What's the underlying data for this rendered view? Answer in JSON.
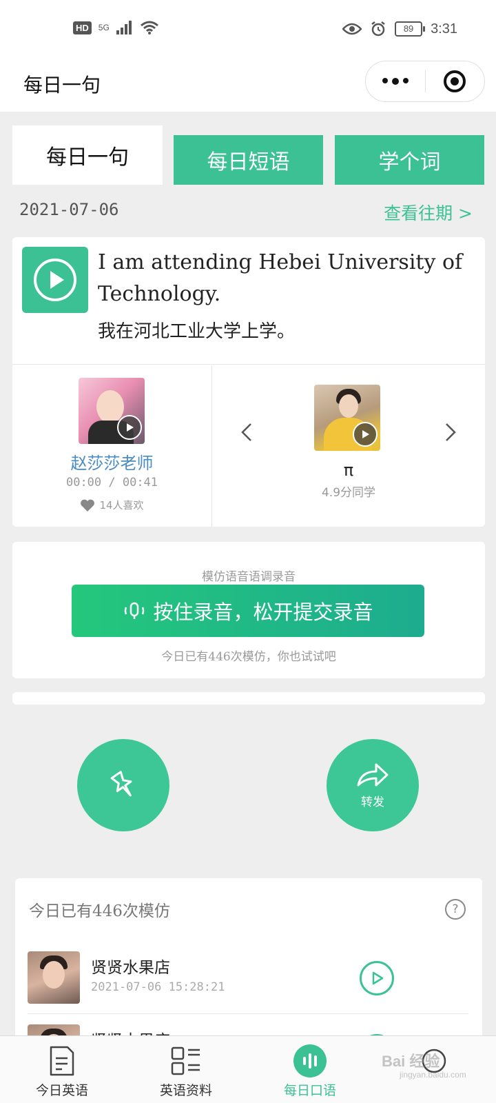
{
  "status_bar": {
    "hd": "HD",
    "network": "5G",
    "battery": "89",
    "time": "3:31"
  },
  "nav": {
    "title": "每日一句"
  },
  "tabs": [
    {
      "label": "每日一句",
      "active": true
    },
    {
      "label": "每日短语",
      "active": false
    },
    {
      "label": "学个词",
      "active": false
    }
  ],
  "date": "2021-07-06",
  "history_link": "查看往期 >",
  "sentence": {
    "english": "I am attending Hebei University of Technology.",
    "chinese": "我在河北工业大学上学。"
  },
  "teacher": {
    "name": "赵莎莎老师",
    "time": "00:00 / 00:41",
    "likes": "14人喜欢"
  },
  "student": {
    "name": "π",
    "score": "4.9分同学"
  },
  "record": {
    "title": "模仿语音语调录音",
    "button_label": "按住录音，松开提交录音",
    "hint": "今日已有446次模仿，你也试试吧"
  },
  "actions": {
    "share_label": "转发"
  },
  "imitations": {
    "header": "今日已有446次模仿",
    "help": "?",
    "rows": [
      {
        "name": "贤贤水果店",
        "time": "2021-07-06 15:28:21"
      },
      {
        "name": "贤贤水果店",
        "time": ""
      }
    ]
  },
  "tabbar": [
    {
      "label": "今日英语",
      "icon": "document-icon",
      "active": false
    },
    {
      "label": "英语资料",
      "icon": "grid-list-icon",
      "active": false
    },
    {
      "label": "每日口语",
      "icon": "audio-bars-icon",
      "active": true
    },
    {
      "label": "",
      "icon": "circle-icon",
      "active": false
    }
  ],
  "watermark": {
    "text": "Bai 经验",
    "sub": "jingyan.baidu.com"
  },
  "colors": {
    "accent": "#3cc194",
    "link_blue": "#4a8bc2",
    "background": "#eeeeee"
  }
}
